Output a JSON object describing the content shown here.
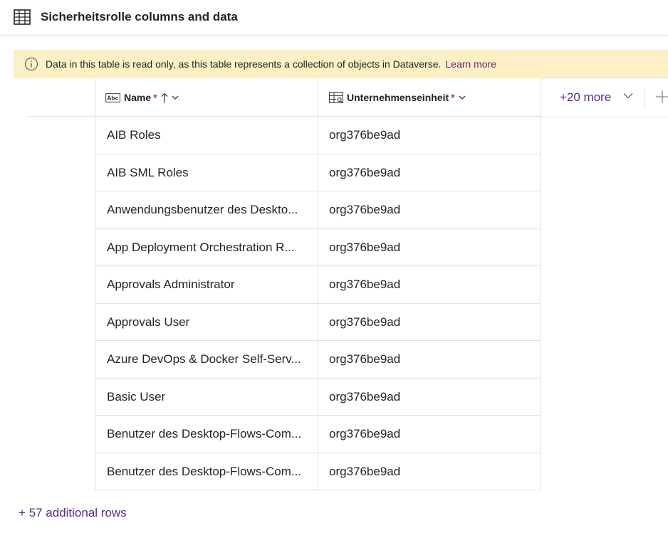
{
  "header": {
    "icon": "table-icon",
    "title": "Sicherheitsrolle columns and data"
  },
  "banner": {
    "icon": "info-icon",
    "message": "Data in this table is read only, as this table represents a collection of objects in Dataverse.",
    "link": "Learn more",
    "background": "#fcf0c4"
  },
  "columns": [
    {
      "label": "Name",
      "required_mark": "*",
      "icon": "text-column-icon",
      "sort": "ascending"
    },
    {
      "label": "Unternehmenseinheit",
      "required_mark": "*",
      "icon": "lookup-column-icon"
    }
  ],
  "more_columns": {
    "label": "+20 more"
  },
  "rows": [
    {
      "name": "AIB Roles",
      "unit": "org376be9ad"
    },
    {
      "name": "AIB SML Roles",
      "unit": "org376be9ad"
    },
    {
      "name": "Anwendungsbenutzer des Deskto...",
      "unit": "org376be9ad"
    },
    {
      "name": "App Deployment Orchestration R...",
      "unit": "org376be9ad"
    },
    {
      "name": "Approvals Administrator",
      "unit": "org376be9ad"
    },
    {
      "name": "Approvals User",
      "unit": "org376be9ad"
    },
    {
      "name": "Azure DevOps & Docker Self-Serv...",
      "unit": "org376be9ad"
    },
    {
      "name": "Basic User",
      "unit": "org376be9ad"
    },
    {
      "name": "Benutzer des Desktop-Flows-Com...",
      "unit": "org376be9ad"
    },
    {
      "name": "Benutzer des Desktop-Flows-Com...",
      "unit": "org376be9ad"
    }
  ],
  "footer": {
    "label": "+ 57 additional rows"
  },
  "colors": {
    "accent": "#5a2a82",
    "required": "#c4314b",
    "border": "#e1e1e1"
  }
}
